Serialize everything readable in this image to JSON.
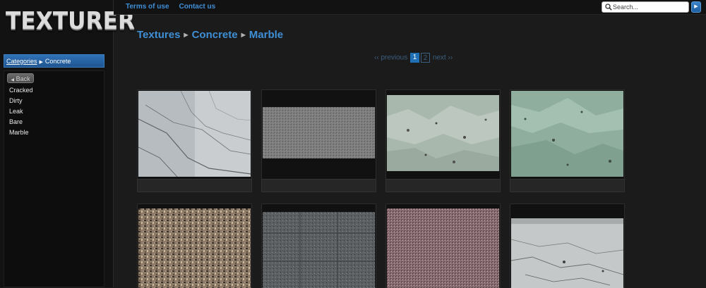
{
  "site": {
    "logo": "TEXTURER"
  },
  "topnav": {
    "items": [
      "Terms of use",
      "Contact us"
    ]
  },
  "search": {
    "placeholder": "Search..."
  },
  "sidebar": {
    "breadcrumb_link": "Categories",
    "breadcrumb_current": "Concrete",
    "back_label": "Back",
    "items": [
      "Cracked",
      "Dirty",
      "Leak",
      "Bare",
      "Marble"
    ]
  },
  "breadcrumb": [
    "Textures",
    "Concrete",
    "Marble"
  ],
  "pagination": {
    "prev": "‹‹ previous",
    "next": "next ››",
    "pages": [
      "1",
      "2"
    ],
    "current": "1"
  },
  "thumbnails": [
    {
      "name": "grey-white-marble"
    },
    {
      "name": "dark-speckled-stone"
    },
    {
      "name": "pale-green-marble"
    },
    {
      "name": "green-marble"
    },
    {
      "name": "brown-granite"
    },
    {
      "name": "grey-tiled-granite"
    },
    {
      "name": "pink-granite"
    },
    {
      "name": "white-veined-marble"
    }
  ],
  "colors": {
    "accent": "#3f8fd6",
    "background": "#1b1b1b",
    "bar": "#1f5591"
  }
}
